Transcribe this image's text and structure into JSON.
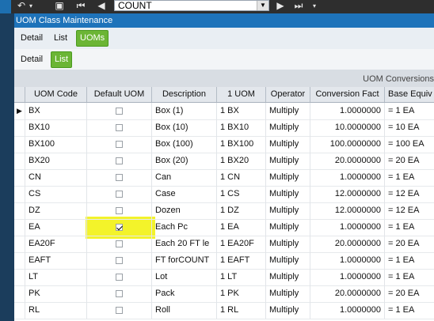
{
  "toolbar": {
    "search_value": "COUNT",
    "icons": [
      "undo-icon",
      "binoculars-icon",
      "first-record-icon",
      "previous-record-icon",
      "next-record-icon",
      "last-record-icon"
    ]
  },
  "window": {
    "title": "UOM Class Maintenance"
  },
  "tabs_top": [
    {
      "label": "Detail",
      "active": false
    },
    {
      "label": "List",
      "active": false
    },
    {
      "label": "UOMs",
      "active": true
    }
  ],
  "tabs_sub": [
    {
      "label": "Detail",
      "active": false
    },
    {
      "label": "List",
      "active": true
    }
  ],
  "grid": {
    "title": "UOM Conversions",
    "columns": [
      "UOM Code",
      "Default UOM",
      "Description",
      "1 UOM",
      "Operator",
      "Conversion Fact",
      "Base Equiv"
    ],
    "rows": [
      {
        "code": "BX",
        "default": false,
        "desc": "Box (1)",
        "one": "1 BX",
        "op": "Multiply",
        "factor": "1.0000000",
        "base": "= 1 EA",
        "current": true
      },
      {
        "code": "BX10",
        "default": false,
        "desc": "Box (10)",
        "one": "1 BX10",
        "op": "Multiply",
        "factor": "10.0000000",
        "base": "= 10 EA"
      },
      {
        "code": "BX100",
        "default": false,
        "desc": "Box (100)",
        "one": "1 BX100",
        "op": "Multiply",
        "factor": "100.0000000",
        "base": "= 100 EA"
      },
      {
        "code": "BX20",
        "default": false,
        "desc": "Box (20)",
        "one": "1 BX20",
        "op": "Multiply",
        "factor": "20.0000000",
        "base": "= 20 EA"
      },
      {
        "code": "CN",
        "default": false,
        "desc": "Can",
        "one": "1 CN",
        "op": "Multiply",
        "factor": "1.0000000",
        "base": "= 1 EA"
      },
      {
        "code": "CS",
        "default": false,
        "desc": "Case",
        "one": "1 CS",
        "op": "Multiply",
        "factor": "12.0000000",
        "base": "= 12 EA"
      },
      {
        "code": "DZ",
        "default": false,
        "desc": "Dozen",
        "one": "1 DZ",
        "op": "Multiply",
        "factor": "12.0000000",
        "base": "= 12 EA"
      },
      {
        "code": "EA",
        "default": true,
        "desc": "Each Pc",
        "one": "1 EA",
        "op": "Multiply",
        "factor": "1.0000000",
        "base": "= 1 EA"
      },
      {
        "code": "EA20F",
        "default": false,
        "desc": "Each 20 FT le",
        "one": "1 EA20F",
        "op": "Multiply",
        "factor": "20.0000000",
        "base": "= 20 EA"
      },
      {
        "code": "EAFT",
        "default": false,
        "desc": "FT forCOUNT",
        "one": "1 EAFT",
        "op": "Multiply",
        "factor": "1.0000000",
        "base": "= 1 EA"
      },
      {
        "code": "LT",
        "default": false,
        "desc": "Lot",
        "one": "1 LT",
        "op": "Multiply",
        "factor": "1.0000000",
        "base": "= 1 EA"
      },
      {
        "code": "PK",
        "default": false,
        "desc": "Pack",
        "one": "1 PK",
        "op": "Multiply",
        "factor": "20.0000000",
        "base": "= 20 EA"
      },
      {
        "code": "RL",
        "default": false,
        "desc": "Roll",
        "one": "1 RL",
        "op": "Multiply",
        "factor": "1.0000000",
        "base": "= 1 EA"
      }
    ]
  },
  "colors": {
    "titlebar": "#1e73ba",
    "active_tab": "#6bb535",
    "highlight": "#f3f32a"
  }
}
